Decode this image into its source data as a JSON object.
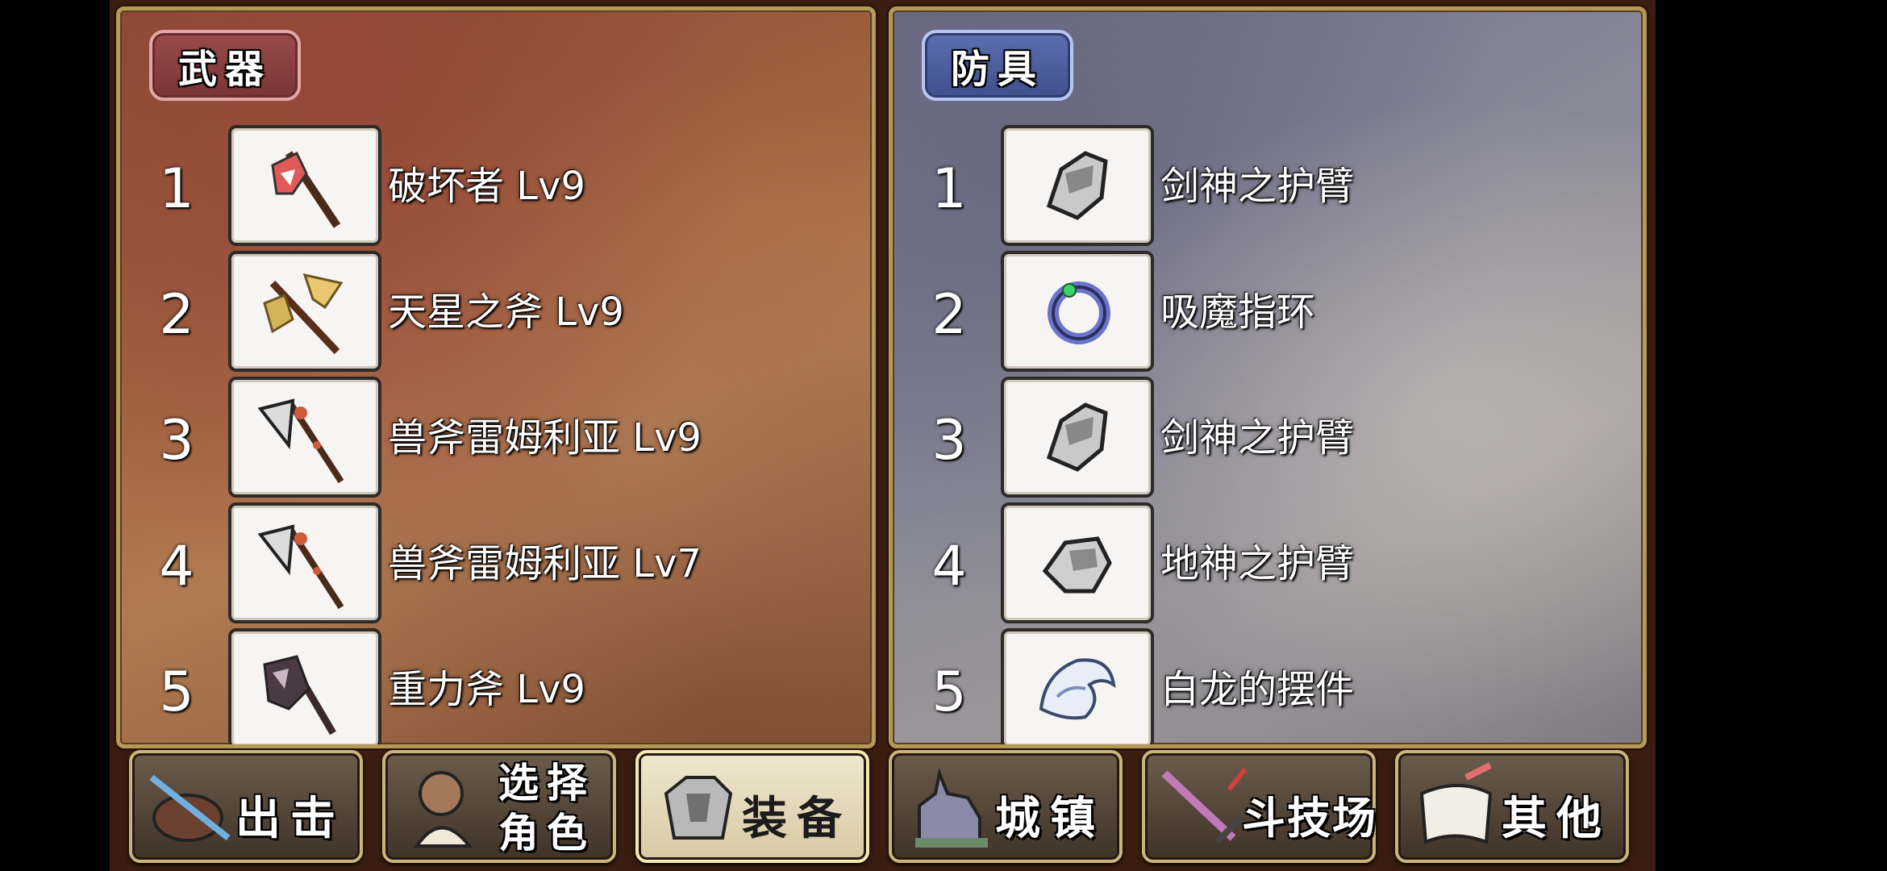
{
  "weapons": {
    "title": "武器",
    "items": [
      {
        "num": "1",
        "name": "破坏者 Lv9",
        "icon": "red-axe-icon"
      },
      {
        "num": "2",
        "name": "天星之斧 Lv9",
        "icon": "golden-axe-icon"
      },
      {
        "num": "3",
        "name": "兽斧雷姆利亚 Lv9",
        "icon": "beast-axe-icon"
      },
      {
        "num": "4",
        "name": "兽斧雷姆利亚 Lv7",
        "icon": "beast-axe-icon"
      },
      {
        "num": "5",
        "name": "重力斧 Lv9",
        "icon": "gravity-axe-icon"
      }
    ]
  },
  "armor": {
    "title": "防具",
    "items": [
      {
        "num": "1",
        "name": "剑神之护臂",
        "icon": "gauntlet-icon"
      },
      {
        "num": "2",
        "name": "吸魔指环",
        "icon": "ring-icon"
      },
      {
        "num": "3",
        "name": "剑神之护臂",
        "icon": "gauntlet-icon"
      },
      {
        "num": "4",
        "name": "地神之护臂",
        "icon": "gauntlet-icon"
      },
      {
        "num": "5",
        "name": "白龙的摆件",
        "icon": "white-dragon-icon"
      }
    ]
  },
  "menu": {
    "sortie": "出击",
    "select_line1": "选择",
    "select_line2": "角色",
    "equip": "装备",
    "town": "城镇",
    "arena": "斗技场",
    "other": "其他"
  }
}
